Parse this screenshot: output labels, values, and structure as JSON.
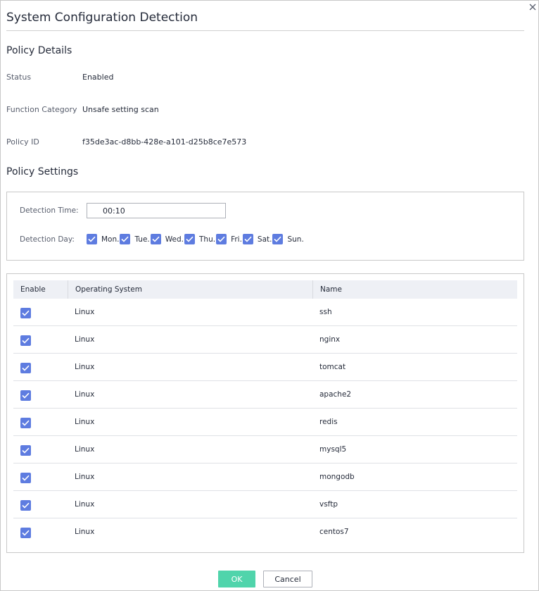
{
  "dialog": {
    "title": "System Configuration Detection",
    "close_icon": "close-icon"
  },
  "policy_details": {
    "title": "Policy Details",
    "fields": [
      {
        "label": "Status",
        "value": "Enabled"
      },
      {
        "label": "Function Category",
        "value": "Unsafe setting scan"
      },
      {
        "label": "Policy ID",
        "value": "f35de3ac-d8bb-428e-a101-d25b8ce7e573"
      }
    ]
  },
  "policy_settings": {
    "title": "Policy Settings",
    "detection_time_label": "Detection Time:",
    "detection_time_value": "00:10",
    "detection_day_label": "Detection Day:",
    "days": [
      {
        "label": "Mon.",
        "checked": true
      },
      {
        "label": "Tue.",
        "checked": true
      },
      {
        "label": "Wed.",
        "checked": true
      },
      {
        "label": "Thu.",
        "checked": true
      },
      {
        "label": "Fri.",
        "checked": true
      },
      {
        "label": "Sat.",
        "checked": true
      },
      {
        "label": "Sun.",
        "checked": true
      }
    ]
  },
  "table": {
    "columns": [
      "Enable",
      "Operating System",
      "Name"
    ],
    "rows": [
      {
        "enabled": true,
        "os": "Linux",
        "name": "ssh"
      },
      {
        "enabled": true,
        "os": "Linux",
        "name": "nginx"
      },
      {
        "enabled": true,
        "os": "Linux",
        "name": "tomcat"
      },
      {
        "enabled": true,
        "os": "Linux",
        "name": "apache2"
      },
      {
        "enabled": true,
        "os": "Linux",
        "name": "redis"
      },
      {
        "enabled": true,
        "os": "Linux",
        "name": "mysql5"
      },
      {
        "enabled": true,
        "os": "Linux",
        "name": "mongodb"
      },
      {
        "enabled": true,
        "os": "Linux",
        "name": "vsftp"
      },
      {
        "enabled": true,
        "os": "Linux",
        "name": "centos7"
      }
    ]
  },
  "buttons": {
    "ok_label": "OK",
    "cancel_label": "Cancel"
  },
  "colors": {
    "checkbox": "#5e7ce0",
    "ok_button": "#50d4ab",
    "table_header": "#eef0f5"
  }
}
